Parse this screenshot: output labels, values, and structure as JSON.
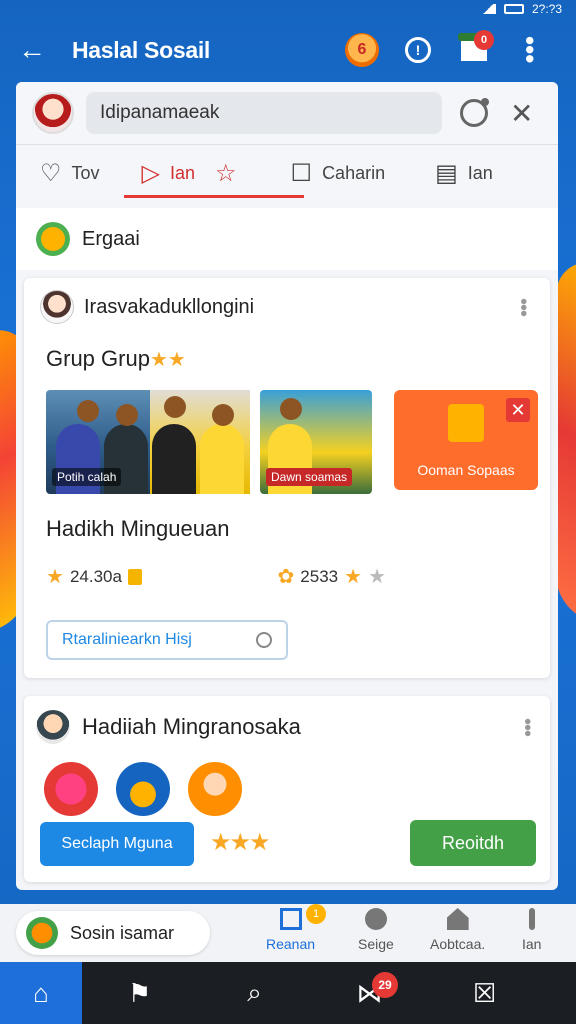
{
  "status": {
    "time": "2?:?3"
  },
  "appbar": {
    "title": "Haslal Sosail",
    "notification_count": "0"
  },
  "search": {
    "value": "Idipanamaeak"
  },
  "tabs": [
    {
      "label": "Tov"
    },
    {
      "label": "Ian"
    },
    {
      "label": ""
    },
    {
      "label": "Caharin"
    },
    {
      "label": "Ian"
    }
  ],
  "section": {
    "title": "Ergaai"
  },
  "post": {
    "author": "Irasvakadukllongini",
    "title": "Grup Grup",
    "photos": [
      {
        "label": "Potih calah"
      },
      {
        "label": ""
      },
      {
        "label": "Dawn soamas"
      }
    ],
    "promo_label": "Ooman Sopaas",
    "subtitle": "Hadikh Mingueuan",
    "stat1": "24.30a",
    "stat2": "2533",
    "link": "Rtaraliniearkn Hisj"
  },
  "post2": {
    "title": "Hadiiah Mingranosaka",
    "blue_button": "Seclaph Mguna",
    "green_button": "Reoitdh"
  },
  "bottom": {
    "pill": "Sosin isamar",
    "nav": [
      {
        "label": "Reanan",
        "badge": "1"
      },
      {
        "label": "Seige"
      },
      {
        "label": "Aobtcaa."
      },
      {
        "label": "Ian"
      }
    ]
  },
  "sysnav": {
    "badge": "29"
  }
}
